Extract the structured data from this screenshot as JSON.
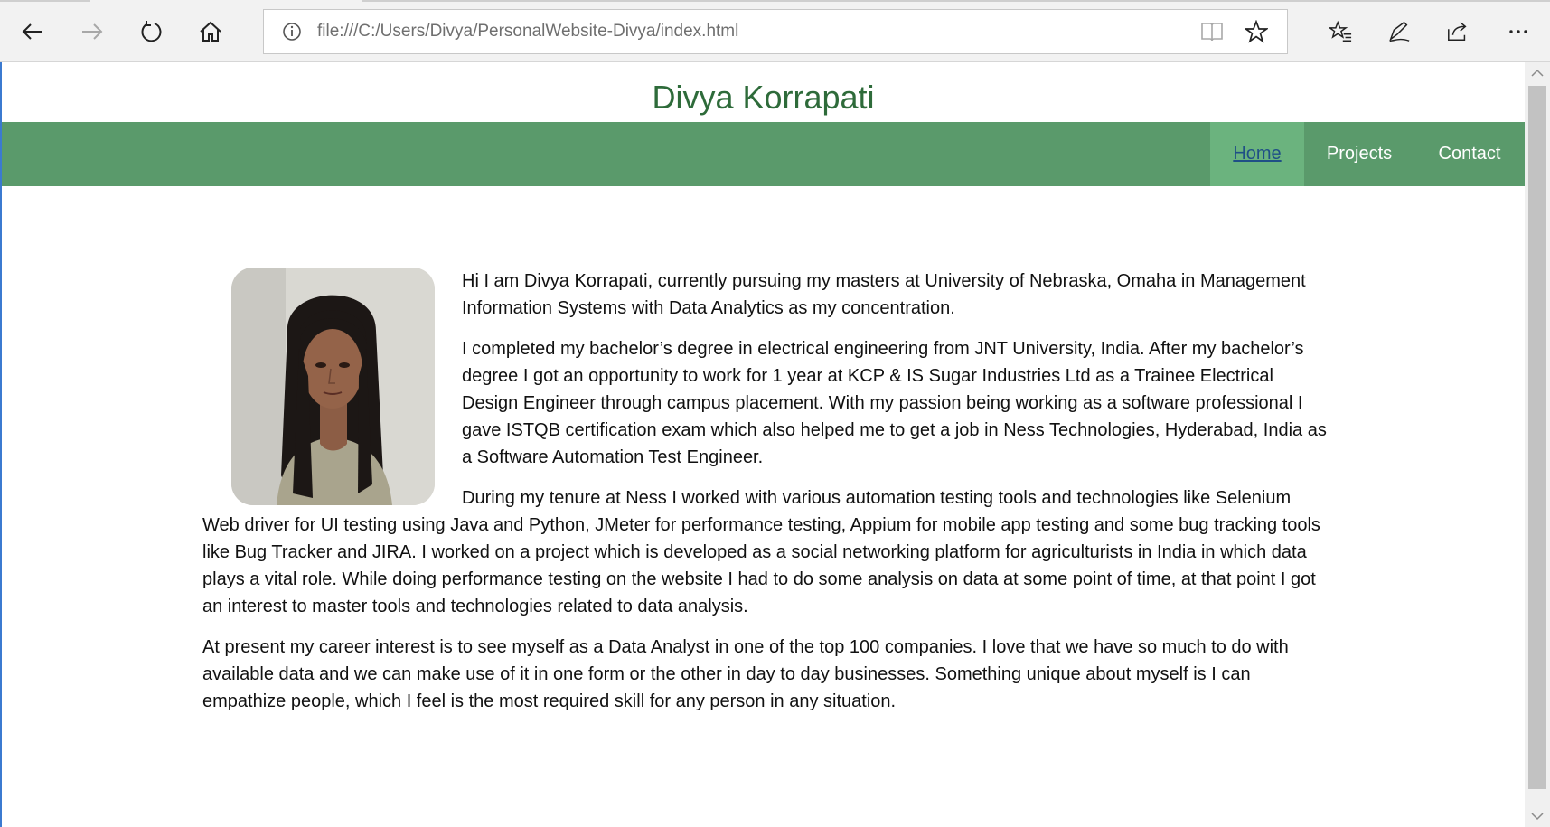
{
  "browser": {
    "address_url": "file:///C:/Users/Divya/PersonalWebsite-Divya/index.html",
    "icons": [
      "back-arrow-icon",
      "forward-arrow-icon",
      "refresh-icon",
      "home-icon",
      "info-icon",
      "reading-view-icon",
      "favorite-star-icon",
      "favorites-hub-icon",
      "pen-icon",
      "share-icon",
      "more-icon"
    ]
  },
  "site": {
    "title": "Divya Korrapati",
    "nav": [
      {
        "label": "Home",
        "active": true
      },
      {
        "label": "Projects"
      },
      {
        "label": "Contact"
      }
    ]
  },
  "about": {
    "paragraphs": [
      "Hi I am Divya Korrapati, currently pursuing my masters at University of Nebraska, Omaha in Management Information Systems with Data Analytics as my concentration.",
      "I completed my bachelor’s degree in electrical engineering from JNT University, India. After my bachelor’s degree I got an opportunity to work for 1 year at KCP & IS Sugar Industries Ltd as a Trainee Electrical Design Engineer through campus placement. With my passion being working as a software professional I gave ISTQB certification exam which also helped me to get a job in Ness Technologies, Hyderabad, India as a Software Automation Test Engineer.",
      "During my tenure at Ness I worked with various automation testing tools and technologies like Selenium Web driver for UI testing using Java and Python, JMeter for performance testing, Appium for mobile app testing and some bug tracking tools like Bug Tracker and JIRA. I worked on a project which is developed as a social networking platform for agriculturists in India in which data plays a vital role. While doing performance testing on the website I had to do some analysis on data at some point of time, at that point I got an interest to master tools and technologies related to data analysis.",
      "At present my career interest is to see myself as a Data Analyst in one of the top 100 companies. I love that we have so much to do with available data and we can make use of it in one form or the other in day to day businesses. Something unique about myself is I can empathize people, which I feel is the most required skill for any person in any situation."
    ]
  },
  "colors": {
    "title_green": "#2e6b3a",
    "nav_green": "#5a9a6b",
    "nav_active": "#6bb37e",
    "link_blue": "#1f4f86"
  }
}
